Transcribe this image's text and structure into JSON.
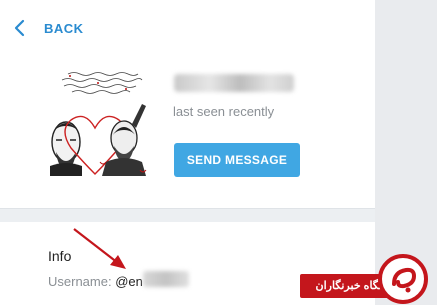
{
  "header": {
    "back_label": "BACK"
  },
  "profile": {
    "status": "last seen recently",
    "send_button_label": "SEND MESSAGE"
  },
  "info": {
    "title": "Info",
    "username_label": "Username:",
    "username_value": "@en"
  },
  "watermark": {
    "text": "باشگاه خبرنگاران"
  },
  "colors": {
    "accent": "#2a8bd0",
    "button": "#40a7e3",
    "arrow": "#c4161c"
  }
}
